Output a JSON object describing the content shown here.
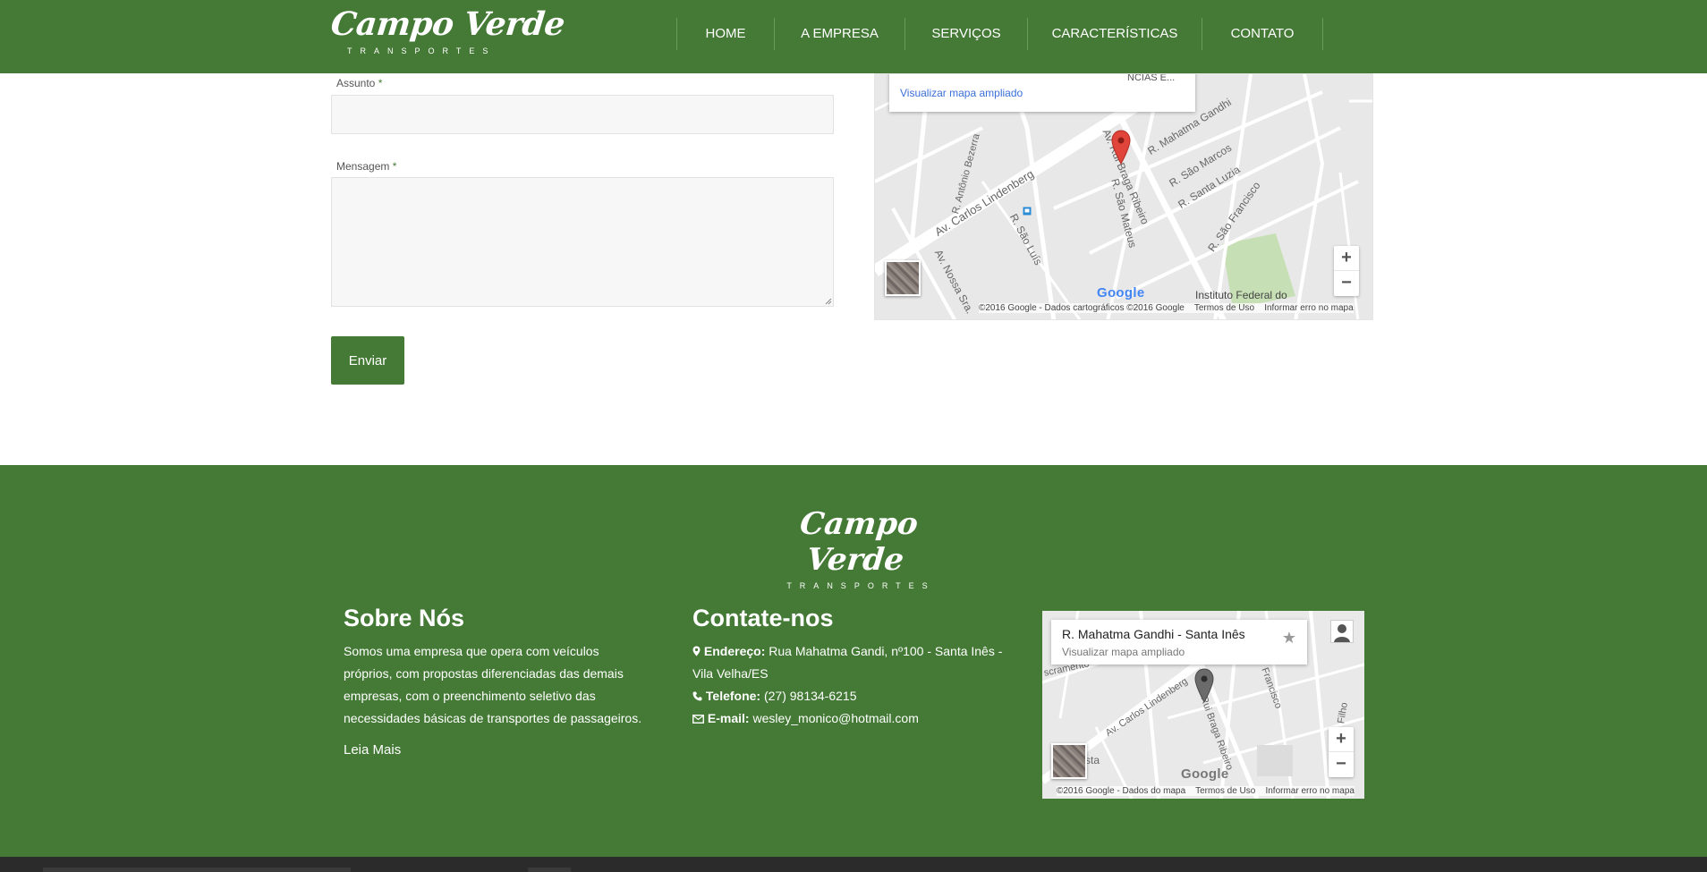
{
  "brand": {
    "name": "Campo Verde",
    "tagline": "TRANSPORTES"
  },
  "nav": {
    "items": [
      "HOME",
      "A EMPRESA",
      "SERVIÇOS",
      "CARACTERÍSTICAS",
      "CONTATO"
    ]
  },
  "form": {
    "subject_label": "Assunto",
    "message_label": "Mensagem",
    "required_mark": "*",
    "submit_label": "Enviar"
  },
  "contact_map": {
    "link": "Visualizar mapa ampliado",
    "partial_label": "NCIAS E...",
    "streets": [
      "R. Antônio Bezerra",
      "Av. Carlos Lindenberg",
      "R. Mahatma Gandhi",
      "R. São Marcos",
      "Av. Rui Braga Ribeiro",
      "R. Santa Luzia",
      "R. São Francisco",
      "R. São Mateus",
      "R. São Luís",
      "Av. Nossa Sra."
    ],
    "poi": "Instituto Federal do",
    "zoom_in": "+",
    "zoom_out": "−",
    "google": "Google",
    "attribution": "©2016 Google - Dados cartográficos ©2016 Google",
    "terms": "Termos de Uso",
    "report": "Informar erro no mapa"
  },
  "footer": {
    "about": {
      "title": "Sobre Nós",
      "text_lines": [
        "Somos uma empresa que opera com veículos",
        "próprios, com propostas diferenciadas das demais",
        "empresas, com o preenchimento seletivo das",
        "necessidades básicas de transportes de passageiros."
      ],
      "more": "Leia Mais"
    },
    "contact": {
      "title": "Contate-nos",
      "address_label": "Endereço:",
      "address_line1": "Rua Mahatma Gandi, nº100 - Santa Inês -",
      "address_line2": "Vila Velha/ES",
      "phone_label": "Telefone:",
      "phone": "(27) 98134-6215",
      "email_label": "E-mail:",
      "email": "wesley_monico@hotmail.com"
    },
    "map": {
      "place": "R. Mahatma Gandhi - Santa Inês",
      "link": "Visualizar mapa ampliado",
      "star": "★",
      "zoom_in": "+",
      "zoom_out": "−",
      "google": "Google",
      "attribution": "©2016 Google - Dados do mapa",
      "terms": "Termos de Uso",
      "report": "Informar erro no mapa",
      "streets": [
        "Av. Carlos Lindenberg",
        "Rui Braga Ribeiro",
        "Francisco",
        "Filho",
        "scramento",
        "sta"
      ]
    }
  },
  "colors": {
    "brand_green": "#447a35",
    "link_blue": "#3a6fd8",
    "marker_red": "#e0443a"
  }
}
